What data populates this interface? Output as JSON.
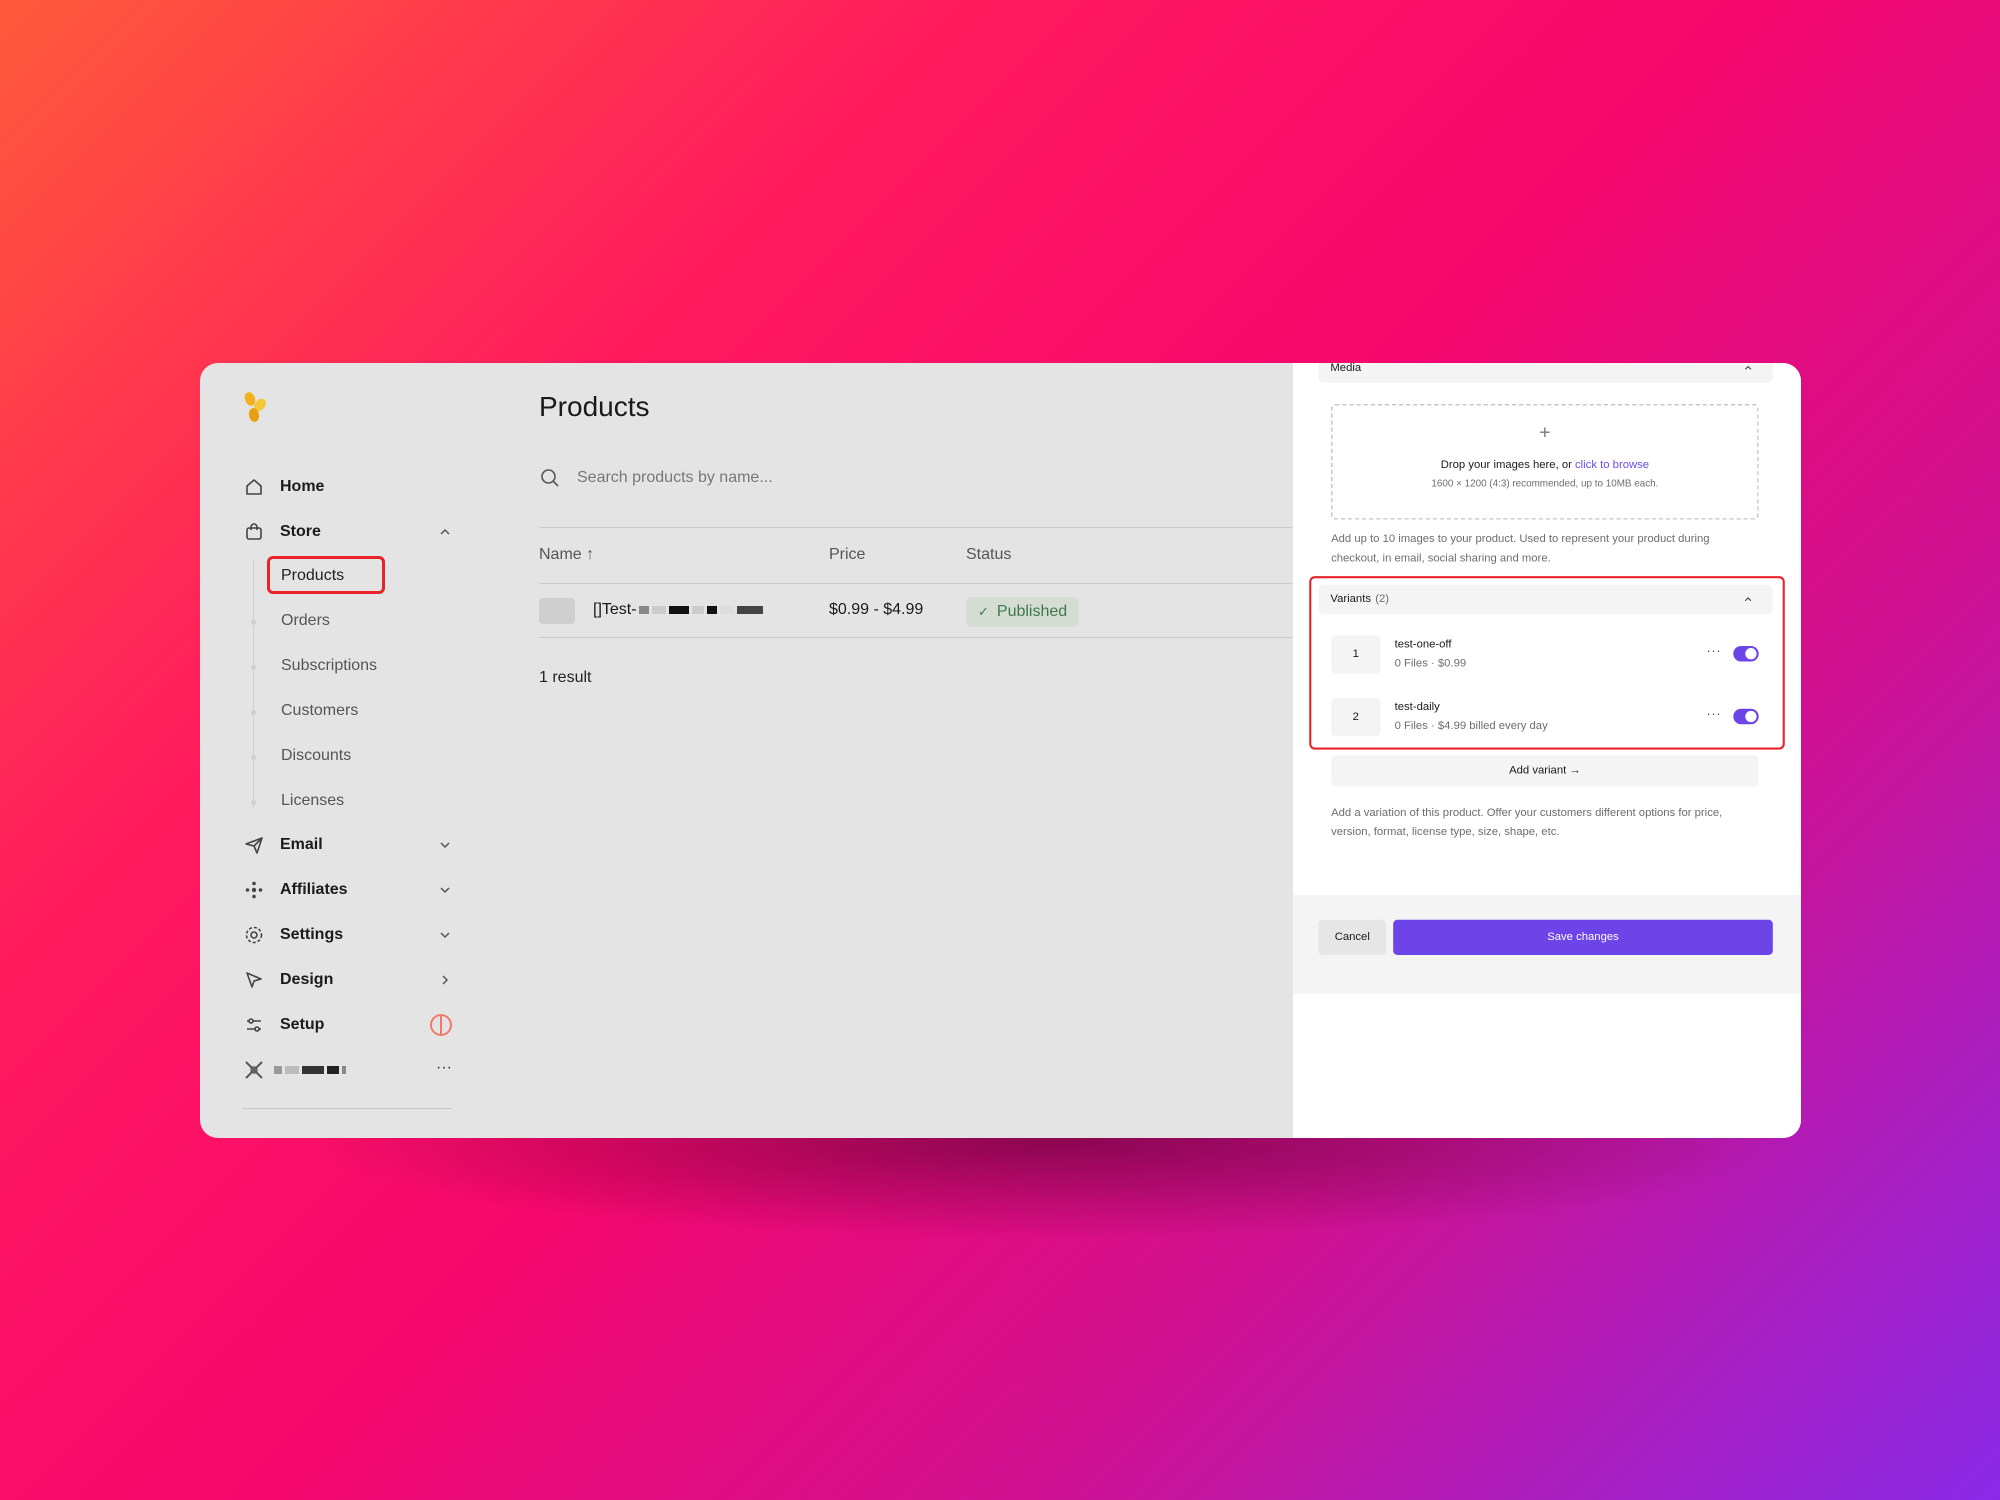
{
  "sidebar": {
    "items": [
      {
        "label": "Home",
        "icon": "home-icon"
      },
      {
        "label": "Store",
        "icon": "shopping-bag-icon"
      },
      {
        "label": "Email",
        "icon": "send-icon"
      },
      {
        "label": "Affiliates",
        "icon": "affiliates-icon"
      },
      {
        "label": "Settings",
        "icon": "gear-icon"
      },
      {
        "label": "Design",
        "icon": "cursor-icon"
      },
      {
        "label": "Setup",
        "icon": "sliders-icon"
      }
    ],
    "store_subitems": [
      "Products",
      "Orders",
      "Subscriptions",
      "Customers",
      "Discounts",
      "Licenses"
    ],
    "active_subitem": "Products",
    "user_more": "···"
  },
  "main": {
    "title": "Products",
    "search_placeholder": "Search products by name...",
    "columns": [
      "Name ↑",
      "Price",
      "Status"
    ],
    "rows": [
      {
        "name_prefix": "[]Test-",
        "price": "$0.99 - $4.99",
        "status": "Published"
      }
    ],
    "result_count": "1 result"
  },
  "panel": {
    "media_header": "Media",
    "dropzone_text": "Drop your images here, or ",
    "dropzone_link": "click to browse",
    "dropzone_hint": "1600 × 1200 (4:3) recommended, up to 10MB each.",
    "media_help": "Add up to 10 images to your product. Used to represent your product during checkout, in email, social sharing and more.",
    "variants_header": "Variants",
    "variants_count": "(2)",
    "variants": [
      {
        "num": "1",
        "name": "test-one-off",
        "meta": "0 Files · $0.99",
        "enabled": true
      },
      {
        "num": "2",
        "name": "test-daily",
        "meta": "0 Files · $4.99 billed every day",
        "enabled": true
      }
    ],
    "add_variant_label": "Add variant →",
    "variants_help": "Add a variation of this product. Offer your customers different options for price, version, format, license type, size, shape, etc.",
    "cancel_label": "Cancel",
    "save_label": "Save changes"
  },
  "colors": {
    "accent": "#6c44e8",
    "highlight": "#e8242a",
    "published": "#3d7a4a"
  }
}
